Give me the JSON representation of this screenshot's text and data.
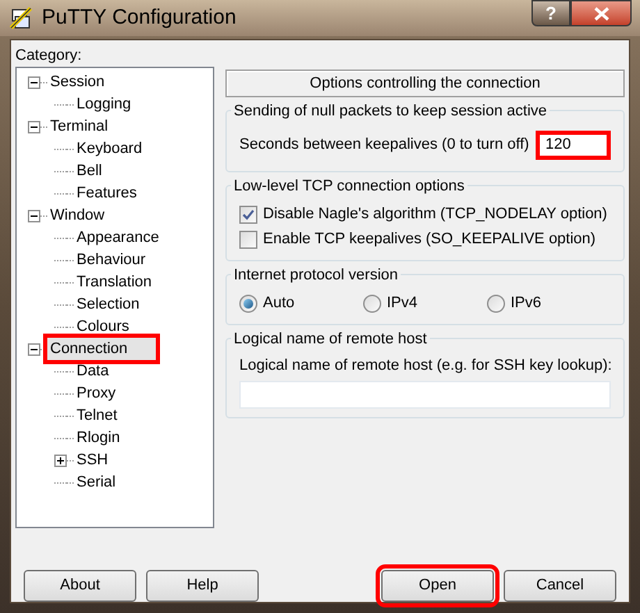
{
  "window": {
    "title": "PuTTY Configuration",
    "help_button": "?"
  },
  "category_label": "Category:",
  "tree": [
    {
      "label": "Session",
      "expanded": true,
      "selected": false,
      "highlighted": false,
      "children": [
        {
          "label": "Logging",
          "selected": false,
          "highlighted": false
        }
      ]
    },
    {
      "label": "Terminal",
      "expanded": true,
      "selected": false,
      "highlighted": false,
      "children": [
        {
          "label": "Keyboard",
          "selected": false,
          "highlighted": false
        },
        {
          "label": "Bell",
          "selected": false,
          "highlighted": false
        },
        {
          "label": "Features",
          "selected": false,
          "highlighted": false
        }
      ]
    },
    {
      "label": "Window",
      "expanded": true,
      "selected": false,
      "highlighted": false,
      "children": [
        {
          "label": "Appearance",
          "selected": false,
          "highlighted": false
        },
        {
          "label": "Behaviour",
          "selected": false,
          "highlighted": false
        },
        {
          "label": "Translation",
          "selected": false,
          "highlighted": false
        },
        {
          "label": "Selection",
          "selected": false,
          "highlighted": false
        },
        {
          "label": "Colours",
          "selected": false,
          "highlighted": false
        }
      ]
    },
    {
      "label": "Connection",
      "expanded": true,
      "selected": true,
      "highlighted": true,
      "children": [
        {
          "label": "Data",
          "selected": false,
          "highlighted": false
        },
        {
          "label": "Proxy",
          "selected": false,
          "highlighted": false
        },
        {
          "label": "Telnet",
          "selected": false,
          "highlighted": false
        },
        {
          "label": "Rlogin",
          "selected": false,
          "highlighted": false
        },
        {
          "label": "SSH",
          "expanded": false,
          "selected": false,
          "highlighted": false
        },
        {
          "label": "Serial",
          "selected": false,
          "highlighted": false
        }
      ]
    }
  ],
  "panel_title": "Options controlling the connection",
  "groups": [
    {
      "title": "Sending of null packets to keep session active",
      "items": [
        {
          "kind": "field",
          "label": "Seconds between keepalives (0 to turn off)",
          "value": "120",
          "highlighted": true
        }
      ]
    },
    {
      "title": "Low-level TCP connection options",
      "items": [
        {
          "kind": "checkbox",
          "label": "Disable Nagle's algorithm (TCP_NODELAY option)",
          "checked": true
        },
        {
          "kind": "checkbox",
          "label": "Enable TCP keepalives (SO_KEEPALIVE option)",
          "checked": false
        }
      ]
    },
    {
      "title": "Internet protocol version",
      "items": [
        {
          "kind": "radios",
          "options": [
            {
              "label": "Auto",
              "selected": true
            },
            {
              "label": "IPv4",
              "selected": false
            },
            {
              "label": "IPv6",
              "selected": false
            }
          ]
        }
      ]
    },
    {
      "title": "Logical name of remote host",
      "items": [
        {
          "kind": "wide_field",
          "label": "Logical name of remote host (e.g. for SSH key lookup):",
          "value": ""
        }
      ]
    }
  ],
  "buttons_left": [
    {
      "label": "About",
      "highlighted": false
    },
    {
      "label": "Help",
      "highlighted": false
    }
  ],
  "buttons_right": [
    {
      "label": "Open",
      "highlighted": true
    },
    {
      "label": "Cancel",
      "highlighted": false
    }
  ]
}
